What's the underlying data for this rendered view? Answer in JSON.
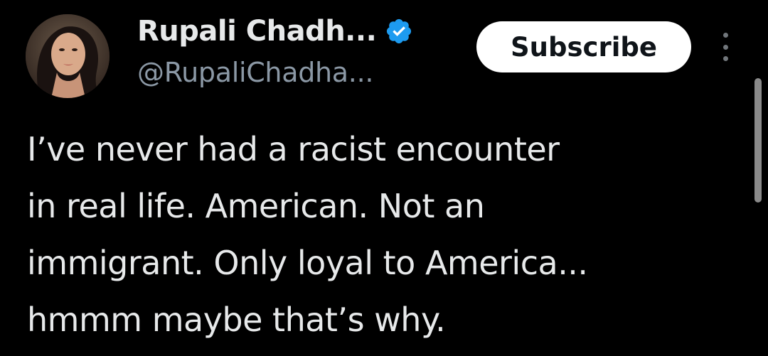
{
  "author": {
    "display_name": "Rupali Chadh...",
    "handle": "@RupaliChadha...",
    "verified": true,
    "avatar_icon": "profile-photo"
  },
  "actions": {
    "subscribe_label": "Subscribe",
    "more_icon": "more-vertical-icon"
  },
  "tweet": {
    "lines": [
      "I’ve never had a racist encounter",
      "in real life. American. Not an",
      "immigrant. Only loyal to America...",
      "hmmm maybe that’s why."
    ]
  },
  "colors": {
    "background": "#000000",
    "text_primary": "#e7e9ea",
    "text_secondary": "#8b98a5",
    "verified_blue": "#1d9bf0",
    "button_bg": "#ffffff",
    "button_text": "#0f1419"
  }
}
